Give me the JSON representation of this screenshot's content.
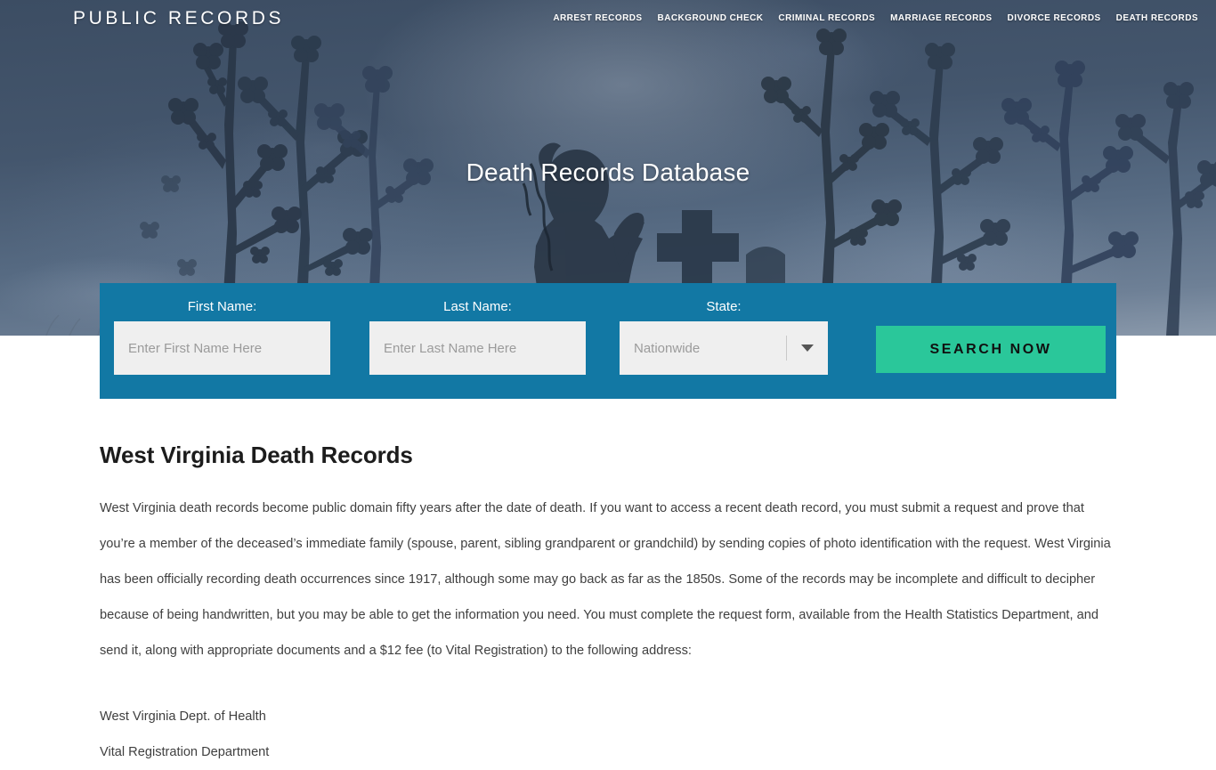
{
  "header": {
    "logo": "PUBLIC RECORDS",
    "nav": [
      {
        "label": "ARREST RECORDS"
      },
      {
        "label": "BACKGROUND CHECK"
      },
      {
        "label": "CRIMINAL RECORDS"
      },
      {
        "label": "MARRIAGE RECORDS"
      },
      {
        "label": "DIVORCE RECORDS"
      },
      {
        "label": "DEATH RECORDS"
      }
    ]
  },
  "hero": {
    "title": "Death Records Database",
    "background_colors": {
      "sky_top": "#3c4d63",
      "sky_bottom": "#8a99ab",
      "silhouette": "#2b3849"
    }
  },
  "search_form": {
    "background_color": "#1278a4",
    "first_name": {
      "label": "First Name:",
      "placeholder": "Enter First Name Here",
      "value": ""
    },
    "last_name": {
      "label": "Last Name:",
      "placeholder": "Enter Last Name Here",
      "value": ""
    },
    "state": {
      "label": "State:",
      "selected": "Nationwide",
      "chevron_icon": "chevron-down-icon"
    },
    "submit": {
      "label": "SEARCH NOW",
      "color": "#2ac79a"
    }
  },
  "content": {
    "title": "West Virginia Death Records",
    "paragraph": "West Virginia death records become public domain fifty years after the date of death. If you want to access a recent death record, you must submit a request and prove that you’re a member of the deceased’s immediate family (spouse, parent, sibling grandparent or grandchild) by sending copies of photo identification with the request. West Virginia has been officially recording death occurrences since 1917, although some may go back as far as the 1850s. Some of the records may be incomplete and difficult to decipher because of being handwritten, but you may be able to get the information you need. You must complete the request form, available from the Health Statistics Department, and send it, along with appropriate documents and a $12 fee (to Vital Registration) to the following address:",
    "address": [
      "West Virginia Dept. of Health",
      "Vital Registration Department"
    ]
  }
}
